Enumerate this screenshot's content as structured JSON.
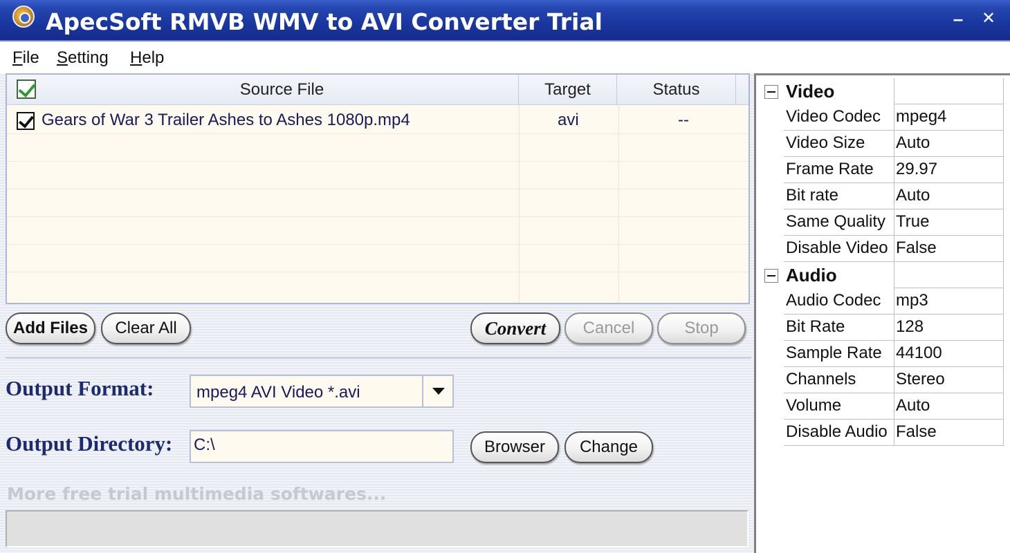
{
  "window": {
    "title": "ApecSoft RMVB WMV to AVI Converter Trial",
    "minimize": "–",
    "close": "✕"
  },
  "menu": [
    {
      "label_ul": "F",
      "label_rest": "ile"
    },
    {
      "label_ul": "S",
      "label_rest": "etting"
    },
    {
      "label_ul": "H",
      "label_rest": "elp"
    }
  ],
  "file_list": {
    "columns": [
      "Source File",
      "Target",
      "Status"
    ],
    "rows": [
      {
        "checked": true,
        "source": "Gears of War 3 Trailer Ashes to Ashes 1080p.mp4",
        "target": "avi",
        "status": "--"
      }
    ]
  },
  "buttons": {
    "add_files": "Add Files",
    "clear_all": "Clear All",
    "convert": "Convert",
    "cancel": "Cancel",
    "stop": "Stop",
    "browser": "Browser",
    "change": "Change"
  },
  "output": {
    "format_label": "Output Format:",
    "format_value": "mpeg4 AVI Video *.avi",
    "directory_label": "Output Directory:",
    "directory_value": "C:\\"
  },
  "more_link": "More free trial multimedia softwares...",
  "properties": {
    "video": {
      "title": "Video",
      "items": [
        {
          "name": "Video Codec",
          "value": "mpeg4"
        },
        {
          "name": "Video Size",
          "value": "Auto"
        },
        {
          "name": "Frame Rate",
          "value": "29.97"
        },
        {
          "name": "Bit rate",
          "value": "Auto"
        },
        {
          "name": "Same Quality",
          "value": "True"
        },
        {
          "name": "Disable Video",
          "value": "False"
        }
      ]
    },
    "audio": {
      "title": "Audio",
      "items": [
        {
          "name": "Audio Codec",
          "value": "mp3"
        },
        {
          "name": "Bit Rate",
          "value": "128"
        },
        {
          "name": "Sample Rate",
          "value": "44100"
        },
        {
          "name": "Channels",
          "value": "Stereo"
        },
        {
          "name": "Volume",
          "value": "Auto"
        },
        {
          "name": "Disable Audio",
          "value": "False"
        }
      ]
    }
  }
}
